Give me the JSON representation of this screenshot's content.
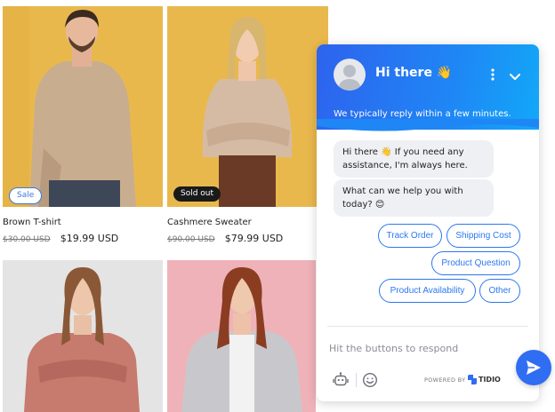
{
  "products": [
    {
      "title": "Brown T-shirt",
      "old_price": "$30.00 USD",
      "price": "$19.99 USD",
      "badge": "Sale"
    },
    {
      "title": "Cashmere Sweater",
      "old_price": "$90.00 USD",
      "price": "$79.99 USD",
      "badge": "Sold out"
    },
    {
      "title": "",
      "old_price": "",
      "price": "",
      "badge": ""
    },
    {
      "title": "",
      "old_price": "",
      "price": "",
      "badge": ""
    }
  ],
  "colors": {
    "accent": "#2f6df2",
    "header_gradient_start": "#2e63ee",
    "header_gradient_end": "#12a8f8",
    "bg_yellow": "#e9b84d",
    "bg_grey": "#e3e3e3",
    "bg_pink": "#efb2b8"
  },
  "chat": {
    "header": {
      "title": "Hi there 👋",
      "subtitle": "We typically reply within a few minutes.",
      "avatar_icon": "user-avatar-icon",
      "menu_icon": "more-vertical-icon",
      "collapse_icon": "chevron-down-icon"
    },
    "messages": [
      {
        "text": "Hi there 👋 If you need any assistance, I'm always here."
      },
      {
        "text": "What can we help you with today? 😊"
      }
    ],
    "quick_replies": [
      "Track Order",
      "Shipping Cost",
      "Product Question",
      "Product Availability",
      "Other"
    ],
    "composer": {
      "placeholder": "Hit the buttons to respond",
      "bot_icon": "bot-icon",
      "emoji_icon": "emoji-icon",
      "send_icon": "send-icon"
    },
    "footer": {
      "powered_by": "POWERED BY",
      "brand": "TIDIO"
    }
  }
}
